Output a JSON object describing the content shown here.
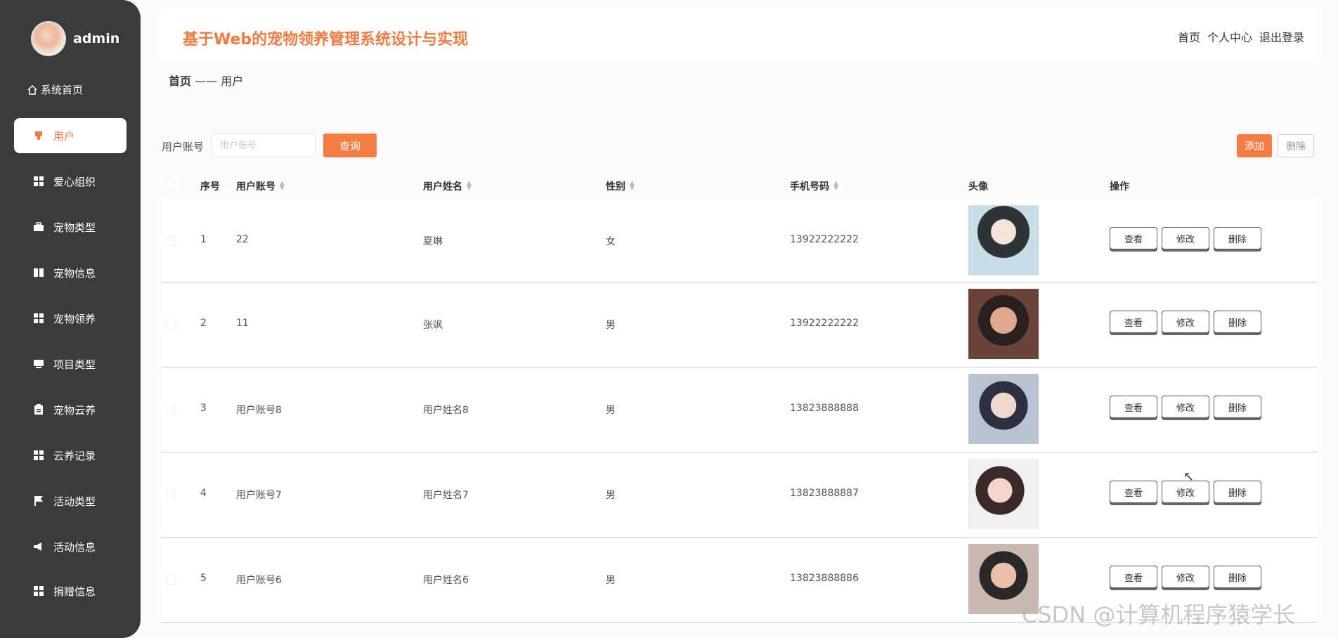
{
  "sidebar": {
    "username": "admin",
    "home_label": "系统首页",
    "items": [
      {
        "label": "用户",
        "icon": "user-icon",
        "active": true
      },
      {
        "label": "爱心组织",
        "icon": "grid-icon"
      },
      {
        "label": "宠物类型",
        "icon": "briefcase-icon"
      },
      {
        "label": "宠物信息",
        "icon": "book-icon"
      },
      {
        "label": "宠物领养",
        "icon": "grid-icon"
      },
      {
        "label": "项目类型",
        "icon": "monitor-icon"
      },
      {
        "label": "宠物云养",
        "icon": "clipboard-icon"
      },
      {
        "label": "云养记录",
        "icon": "grid-icon"
      },
      {
        "label": "活动类型",
        "icon": "flag-icon"
      },
      {
        "label": "活动信息",
        "icon": "megaphone-icon"
      },
      {
        "label": "捐赠信息",
        "icon": "grid-icon"
      }
    ]
  },
  "header": {
    "title": "基于Web的宠物领养管理系统设计与实现",
    "links": [
      "首页",
      "个人中心",
      "退出登录"
    ]
  },
  "breadcrumb": {
    "home": "首页",
    "separator": "——",
    "current": "用户"
  },
  "search": {
    "label": "用户账号",
    "placeholder": "用户账号",
    "query_button": "查询"
  },
  "actions": {
    "add": "添加",
    "delete": "删除"
  },
  "table": {
    "columns": [
      "序号",
      "用户账号",
      "用户姓名",
      "性别",
      "手机号码",
      "头像",
      "操作"
    ],
    "sortable": [
      false,
      true,
      true,
      true,
      true,
      false,
      false
    ],
    "row_actions": [
      "查看",
      "修改",
      "删除"
    ],
    "rows": [
      {
        "index": "1",
        "account": "22",
        "name": "夏琳",
        "gender": "女",
        "phone": "13922222222"
      },
      {
        "index": "2",
        "account": "11",
        "name": "张飒",
        "gender": "男",
        "phone": "13922222222"
      },
      {
        "index": "3",
        "account": "用户账号8",
        "name": "用户姓名8",
        "gender": "男",
        "phone": "13823888888"
      },
      {
        "index": "4",
        "account": "用户账号7",
        "name": "用户姓名7",
        "gender": "男",
        "phone": "13823888887"
      },
      {
        "index": "5",
        "account": "用户账号6",
        "name": "用户姓名6",
        "gender": "男",
        "phone": "13823888886"
      }
    ]
  },
  "watermark": "CSDN @计算机程序猿学长",
  "colors": {
    "accent": "#f47d42",
    "sidebar": "#3b3b3b"
  }
}
